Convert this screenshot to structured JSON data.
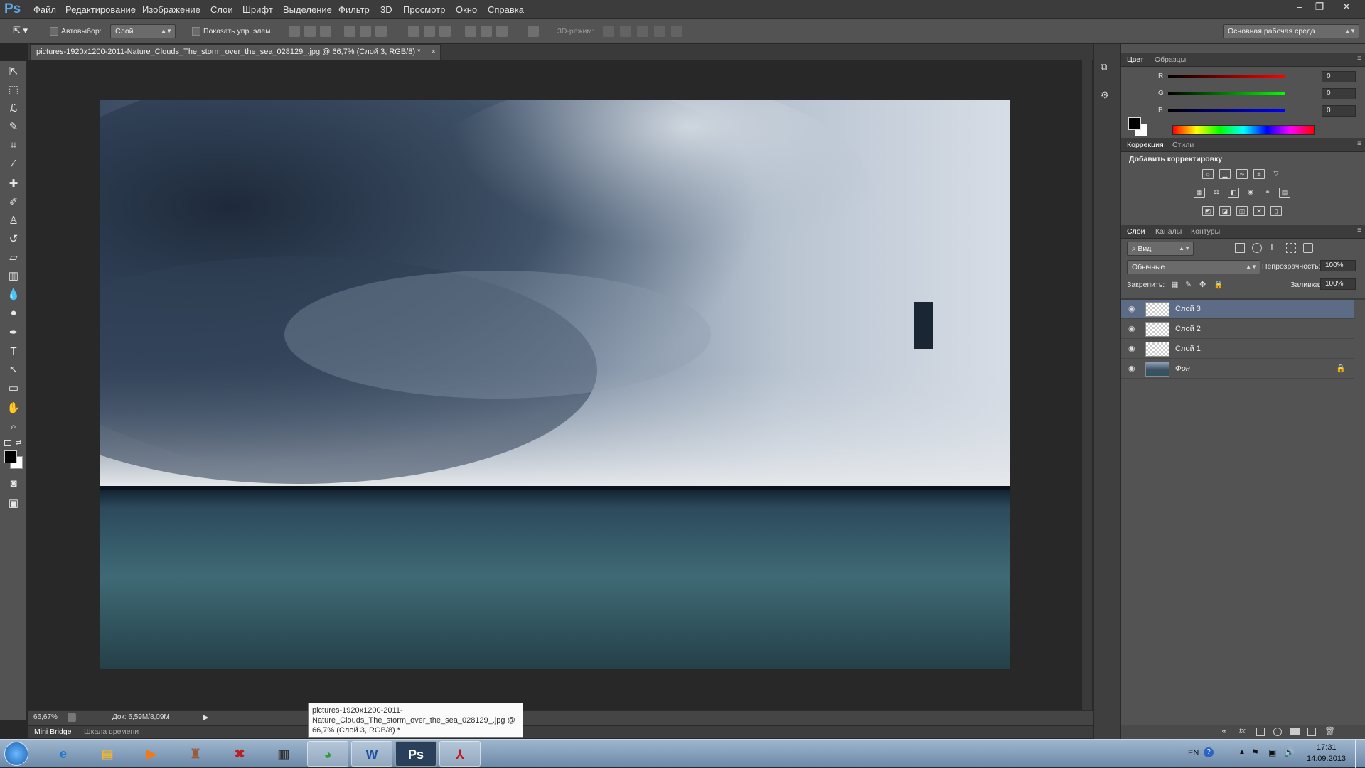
{
  "app": {
    "logo": "Ps"
  },
  "menu": [
    "Файл",
    "Редактирование",
    "Изображение",
    "Слои",
    "Шрифт",
    "Выделение",
    "Фильтр",
    "3D",
    "Просмотр",
    "Окно",
    "Справка"
  ],
  "window_controls": [
    "–",
    "❐",
    "✕"
  ],
  "options": {
    "autoselect_label": "Автовыбор:",
    "autoselect_value": "Слой",
    "show_transform_label": "Показать упр. элем.",
    "mode3d_label": "3D-режим:",
    "workspace": "Основная рабочая среда"
  },
  "document": {
    "tab_title": "pictures-1920x1200-2011-Nature_Clouds_The_storm_over_the_sea_028129_.jpg @ 66,7% (Слой 3, RGB/8) *",
    "tab_close": "×"
  },
  "status": {
    "zoom": "66,67%",
    "doc_info": "Док: 6,59M/8,09M",
    "arrow": "▶"
  },
  "bottom_tabs": [
    "Mini Bridge",
    "Шкала времени"
  ],
  "tooltip": {
    "line1": "pictures-1920x1200-2011-",
    "line2": "Nature_Clouds_The_storm_over_the_sea_028129_.jpg @",
    "line3": "66,7% (Слой 3, RGB/8) *"
  },
  "color_panel": {
    "tabs": [
      "Цвет",
      "Образцы"
    ],
    "channels": [
      {
        "label": "R",
        "value": "0",
        "color": "#e02020"
      },
      {
        "label": "G",
        "value": "0",
        "color": "#20c030"
      },
      {
        "label": "B",
        "value": "0",
        "color": "#2040e0"
      }
    ],
    "foreground": "#000000",
    "background": "#ffffff"
  },
  "adjustments_panel": {
    "tabs": [
      "Коррекция",
      "Стили"
    ],
    "heading": "Добавить корректировку"
  },
  "layers_panel": {
    "tabs": [
      "Слои",
      "Каналы",
      "Контуры"
    ],
    "filter_kind": "Вид",
    "blend_mode": "Обычные",
    "opacity_label": "Непрозрачность:",
    "opacity_value": "100%",
    "lock_label": "Закрепить:",
    "fill_label": "Заливка:",
    "fill_value": "100%",
    "layers": [
      {
        "name": "Слой 3",
        "selected": true
      },
      {
        "name": "Слой 2",
        "selected": false
      },
      {
        "name": "Слой 1",
        "selected": false
      },
      {
        "name": "Фон",
        "selected": false,
        "locked": true
      }
    ],
    "footer_icons": [
      "link-icon",
      "fx-icon",
      "mask-icon",
      "adjustment-icon",
      "group-icon",
      "new-layer-icon",
      "trash-icon"
    ]
  },
  "taskbar": {
    "apps": [
      "start-orb",
      "internet-explorer",
      "file-explorer",
      "media-player",
      "game-app",
      "dota-app",
      "notepad-app",
      "chrome",
      "word",
      "photoshop",
      "acrobat"
    ],
    "lang": "EN",
    "time": "17:31",
    "date": "14.09.2013"
  }
}
